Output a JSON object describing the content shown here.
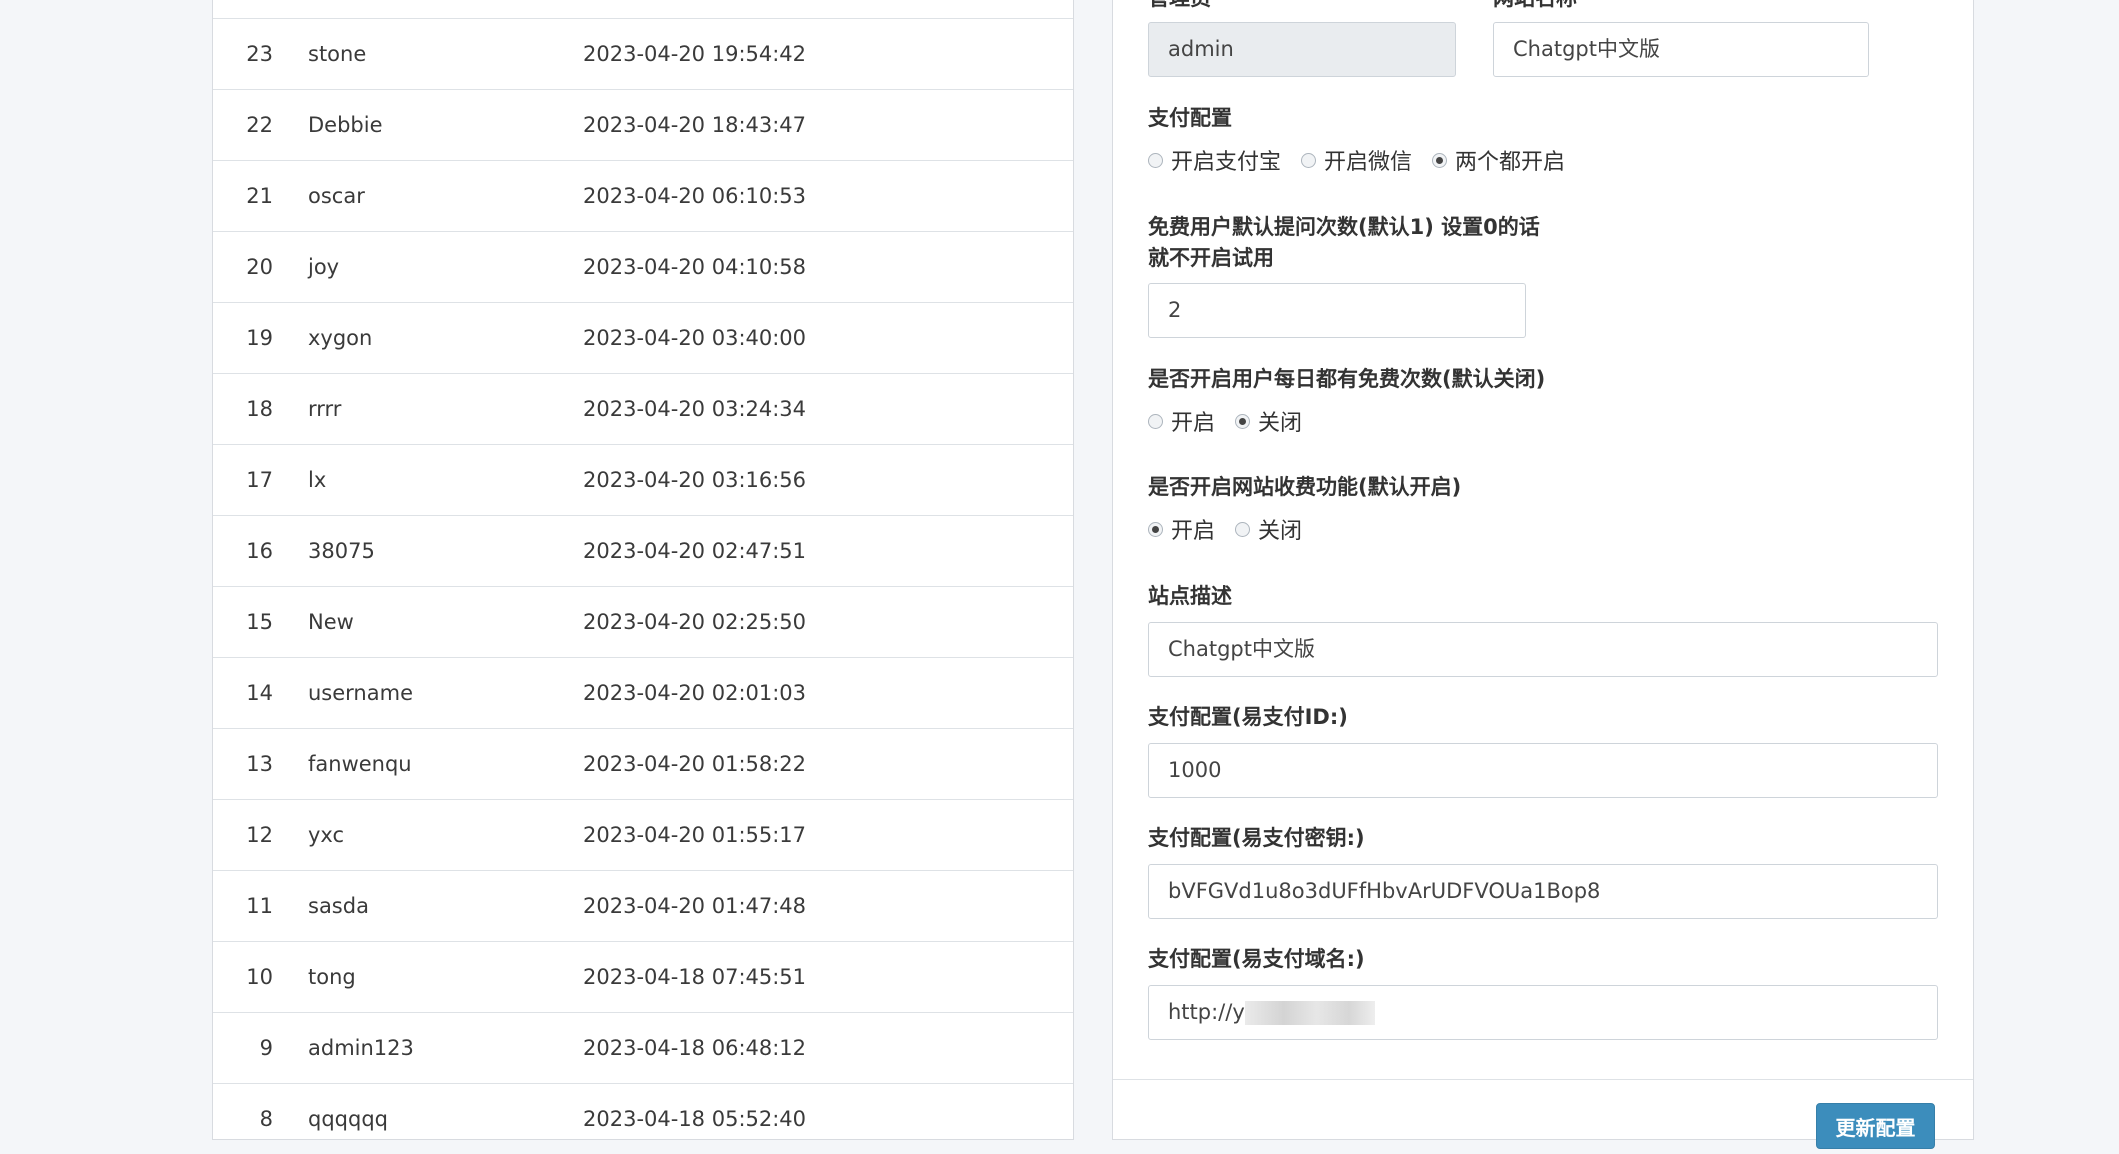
{
  "users_table": {
    "rows": [
      {
        "id": "23",
        "username": "stone",
        "time": "2023-04-20 19:54:42"
      },
      {
        "id": "22",
        "username": "Debbie",
        "time": "2023-04-20 18:43:47"
      },
      {
        "id": "21",
        "username": "oscar",
        "time": "2023-04-20 06:10:53"
      },
      {
        "id": "20",
        "username": "joy",
        "time": "2023-04-20 04:10:58"
      },
      {
        "id": "19",
        "username": "xygon",
        "time": "2023-04-20 03:40:00"
      },
      {
        "id": "18",
        "username": "rrrr",
        "time": "2023-04-20 03:24:34"
      },
      {
        "id": "17",
        "username": "lx",
        "time": "2023-04-20 03:16:56"
      },
      {
        "id": "16",
        "username": "38075",
        "time": "2023-04-20 02:47:51"
      },
      {
        "id": "15",
        "username": "New",
        "time": "2023-04-20 02:25:50"
      },
      {
        "id": "14",
        "username": "username",
        "time": "2023-04-20 02:01:03"
      },
      {
        "id": "13",
        "username": "fanwenqu",
        "time": "2023-04-20 01:58:22"
      },
      {
        "id": "12",
        "username": "yxc",
        "time": "2023-04-20 01:55:17"
      },
      {
        "id": "11",
        "username": "sasda",
        "time": "2023-04-20 01:47:48"
      },
      {
        "id": "10",
        "username": "tong",
        "time": "2023-04-18 07:45:51"
      },
      {
        "id": "9",
        "username": "admin123",
        "time": "2023-04-18 06:48:12"
      },
      {
        "id": "8",
        "username": "qqqqqq",
        "time": "2023-04-18 05:52:40"
      }
    ]
  },
  "settings": {
    "admin_label": "管理员",
    "admin_value": "admin",
    "site_name_label": "网站名称",
    "site_name_value": "Chatgpt中文版",
    "pay_config_label": "支付配置",
    "pay_options": [
      "开启支付宝",
      "开启微信",
      "两个都开启"
    ],
    "pay_selected": "两个都开启",
    "free_count_label_line1": "免费用户默认提问次数(默认1) 设置0的话",
    "free_count_label_line2": "就不开启试用",
    "free_count_value": "2",
    "daily_free_label": "是否开启用户每日都有免费次数(默认关闭)",
    "daily_free_options": [
      "开启",
      "关闭"
    ],
    "daily_free_selected": "关闭",
    "charge_label": "是否开启网站收费功能(默认开启)",
    "charge_options": [
      "开启",
      "关闭"
    ],
    "charge_selected": "开启",
    "site_desc_label": "站点描述",
    "site_desc_value": "Chatgpt中文版",
    "epay_id_label": "支付配置(易支付ID:)",
    "epay_id_value": "1000",
    "epay_key_label": "支付配置(易支付密钥:)",
    "epay_key_value": "bVFGVd1u8o3dUFfHbvArUDFVOUa1Bop8",
    "epay_domain_label": "支付配置(易支付域名:)",
    "epay_domain_value": "http://y",
    "update_button_label": "更新配置"
  }
}
